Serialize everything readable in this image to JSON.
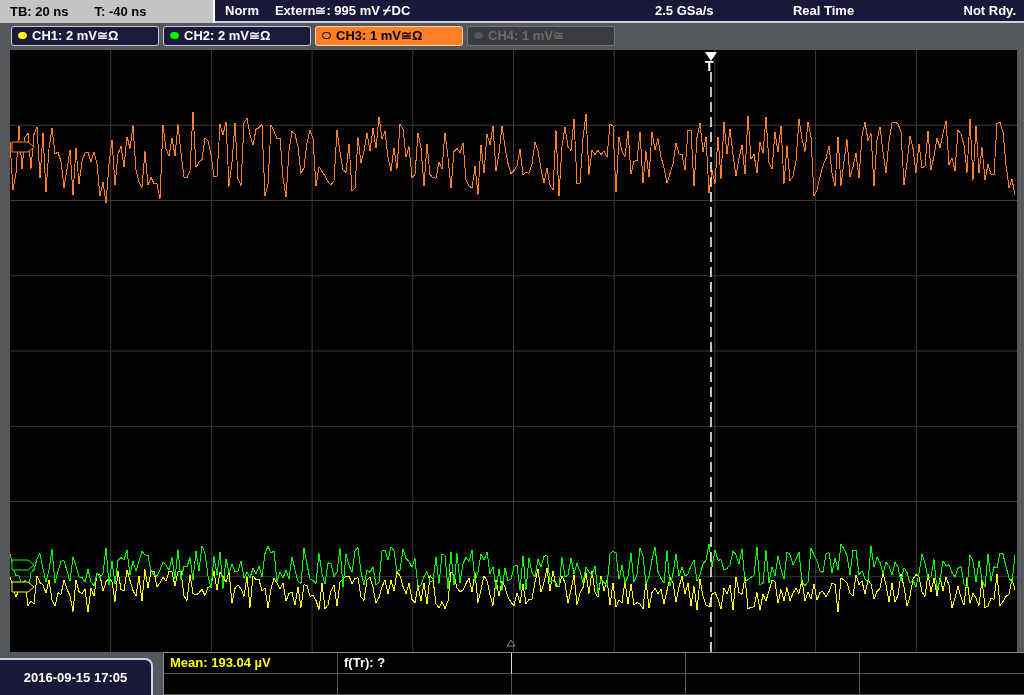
{
  "status_bar": {
    "timebase": "TB: 20 ns",
    "trigger_time": "T: -40 ns",
    "trigger_mode": "Norm",
    "trigger_source": "Extern≅: 995 mV ⌿DC",
    "sample_rate": "2.5 GSa/s",
    "acquisition": "Real Time",
    "state": "Not Rdy."
  },
  "channels": [
    {
      "label": "CH1: 2 mV≅Ω",
      "color": "#ffff00",
      "selected": false,
      "disabled": false
    },
    {
      "label": "CH2: 2 mV≅Ω",
      "color": "#00ff00",
      "selected": false,
      "disabled": false
    },
    {
      "label": "CH3: 1 mV≅Ω",
      "color": "#ff7f27",
      "selected": true,
      "disabled": false
    },
    {
      "label": "CH4: 1 mV≅",
      "color": "#555555",
      "selected": false,
      "disabled": true
    }
  ],
  "trigger_marker": "T",
  "measurements": [
    {
      "text": "Mean: 193.04 µV",
      "color": "#ffff00"
    },
    {
      "text": "f(Tr): ?",
      "color": "#ffffff"
    }
  ],
  "datetime": "2016-09-15 17:05"
}
